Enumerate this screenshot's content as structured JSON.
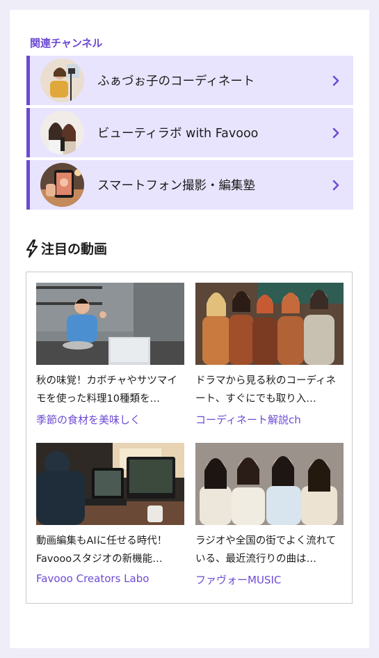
{
  "related": {
    "heading": "関連チャンネル",
    "channels": [
      {
        "name": "ふぁづぉ子のコーディネート",
        "icon": "chevron-right-icon"
      },
      {
        "name": "ビューティラボ with Favooo",
        "icon": "chevron-right-icon"
      },
      {
        "name": "スマートフォン撮影・編集塾",
        "icon": "chevron-right-icon"
      }
    ]
  },
  "featured": {
    "heading": "注目の動画",
    "icon": "lightning-icon",
    "videos": [
      {
        "title": "秋の味覚！カボチャやサツマイモを使った料理10種類を…",
        "channel": "季節の食材を美味しく"
      },
      {
        "title": "ドラマから見る秋のコーディネート、すぐにでも取り入…",
        "channel": "コーディネート解説ch"
      },
      {
        "title": "動画編集もAIに任せる時代！Favoooスタジオの新機能…",
        "channel": "Favooo Creators Labo"
      },
      {
        "title": "ラジオや全国の街でよく流れている、最近流行りの曲は…",
        "channel": "ファヴォーMUSIC"
      }
    ]
  },
  "colors": {
    "accent": "#6d4ad3",
    "row_bg": "#e8e4fe",
    "page_bg": "#eeedf8"
  }
}
